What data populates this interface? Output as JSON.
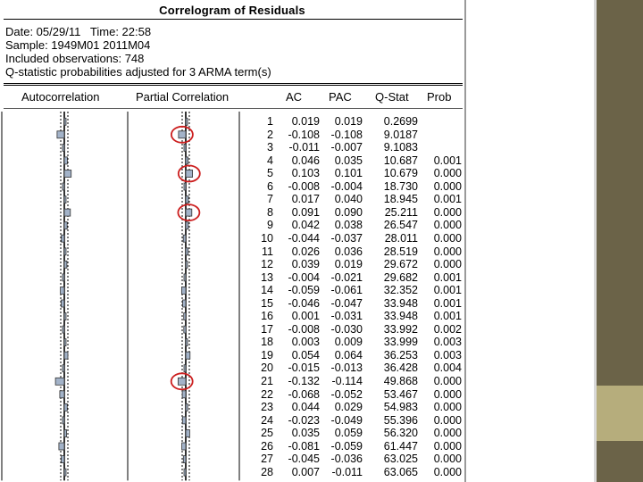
{
  "window": {
    "title": "Correlogram of Residuals",
    "info_lines": [
      "Date: 05/29/11   Time: 22:58",
      "Sample: 1949M01 2011M04",
      "Included observations: 748",
      "Q-statistic probabilities adjusted for 3 ARMA term(s)"
    ]
  },
  "table": {
    "headers": {
      "autocorrelation": "Autocorrelation",
      "partial_correlation": "Partial Correlation",
      "ac": "AC",
      "pac": "PAC",
      "q_stat": "Q-Stat",
      "prob": "Prob"
    },
    "rows": [
      {
        "lag": "1",
        "ac": "0.019",
        "pac": "0.019",
        "q": "0.2699",
        "prob": ""
      },
      {
        "lag": "2",
        "ac": "-0.108",
        "pac": "-0.108",
        "q": "9.0187",
        "prob": ""
      },
      {
        "lag": "3",
        "ac": "-0.011",
        "pac": "-0.007",
        "q": "9.1083",
        "prob": ""
      },
      {
        "lag": "4",
        "ac": "0.046",
        "pac": "0.035",
        "q": "10.687",
        "prob": "0.001"
      },
      {
        "lag": "5",
        "ac": "0.103",
        "pac": "0.101",
        "q": "10.679",
        "prob": "0.000"
      },
      {
        "lag": "6",
        "ac": "-0.008",
        "pac": "-0.004",
        "q": "18.730",
        "prob": "0.000"
      },
      {
        "lag": "7",
        "ac": "0.017",
        "pac": "0.040",
        "q": "18.945",
        "prob": "0.001"
      },
      {
        "lag": "8",
        "ac": "0.091",
        "pac": "0.090",
        "q": "25.211",
        "prob": "0.000"
      },
      {
        "lag": "9",
        "ac": "0.042",
        "pac": "0.038",
        "q": "26.547",
        "prob": "0.000"
      },
      {
        "lag": "10",
        "ac": "-0.044",
        "pac": "-0.037",
        "q": "28.011",
        "prob": "0.000"
      },
      {
        "lag": "11",
        "ac": "0.026",
        "pac": "0.036",
        "q": "28.519",
        "prob": "0.000"
      },
      {
        "lag": "12",
        "ac": "0.039",
        "pac": "0.019",
        "q": "29.672",
        "prob": "0.000"
      },
      {
        "lag": "13",
        "ac": "-0.004",
        "pac": "-0.021",
        "q": "29.682",
        "prob": "0.001"
      },
      {
        "lag": "14",
        "ac": "-0.059",
        "pac": "-0.061",
        "q": "32.352",
        "prob": "0.001"
      },
      {
        "lag": "15",
        "ac": "-0.046",
        "pac": "-0.047",
        "q": "33.948",
        "prob": "0.001"
      },
      {
        "lag": "16",
        "ac": "0.001",
        "pac": "-0.031",
        "q": "33.948",
        "prob": "0.001"
      },
      {
        "lag": "17",
        "ac": "-0.008",
        "pac": "-0.030",
        "q": "33.992",
        "prob": "0.002"
      },
      {
        "lag": "18",
        "ac": "0.003",
        "pac": "0.009",
        "q": "33.999",
        "prob": "0.003"
      },
      {
        "lag": "19",
        "ac": "0.054",
        "pac": "0.064",
        "q": "36.253",
        "prob": "0.003"
      },
      {
        "lag": "20",
        "ac": "-0.015",
        "pac": "-0.013",
        "q": "36.428",
        "prob": "0.004"
      },
      {
        "lag": "21",
        "ac": "-0.132",
        "pac": "-0.114",
        "q": "49.868",
        "prob": "0.000"
      },
      {
        "lag": "22",
        "ac": "-0.068",
        "pac": "-0.052",
        "q": "53.467",
        "prob": "0.000"
      },
      {
        "lag": "23",
        "ac": "0.044",
        "pac": "0.029",
        "q": "54.983",
        "prob": "0.000"
      },
      {
        "lag": "24",
        "ac": "-0.023",
        "pac": "-0.049",
        "q": "55.396",
        "prob": "0.000"
      },
      {
        "lag": "25",
        "ac": "0.035",
        "pac": "0.059",
        "q": "56.320",
        "prob": "0.000"
      },
      {
        "lag": "26",
        "ac": "-0.081",
        "pac": "-0.059",
        "q": "61.447",
        "prob": "0.000"
      },
      {
        "lag": "27",
        "ac": "-0.045",
        "pac": "-0.036",
        "q": "63.025",
        "prob": "0.000"
      },
      {
        "lag": "28",
        "ac": "0.007",
        "pac": "-0.011",
        "q": "63.065",
        "prob": "0.000"
      }
    ]
  },
  "highlighted_pac_lags": [
    2,
    5,
    8,
    21
  ],
  "colors": {
    "bar_fill": "#a3b3c9",
    "bar_stroke": "#333333",
    "highlight_circle": "#cc1f1f",
    "side_band": "#6b6348",
    "side_accent": "#b6ad7c"
  }
}
